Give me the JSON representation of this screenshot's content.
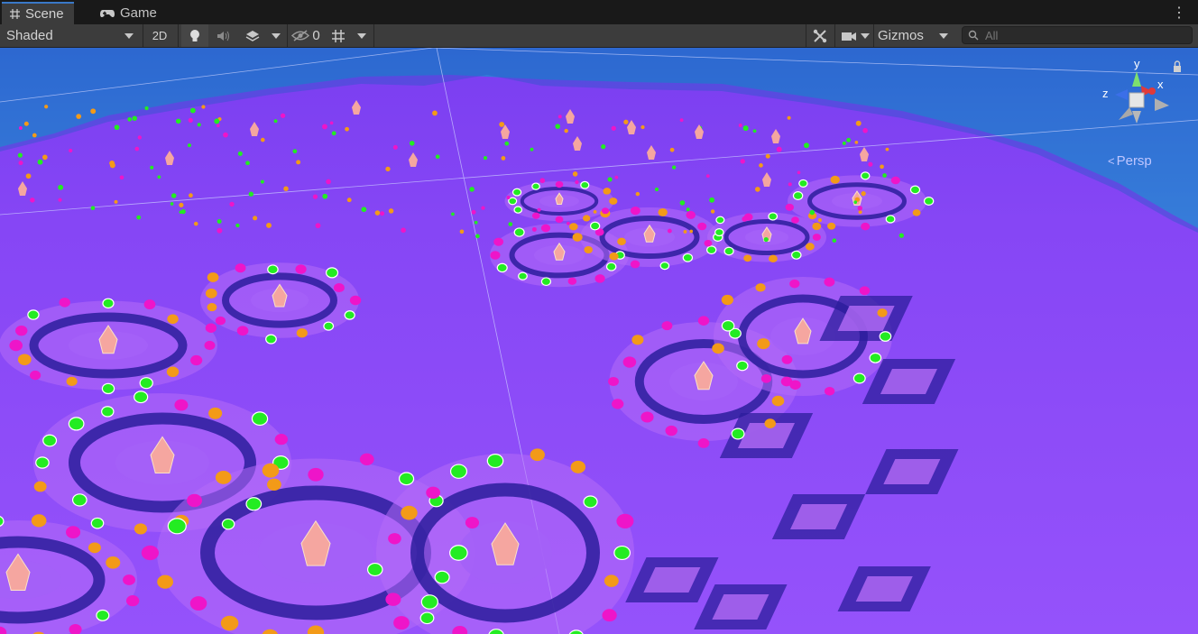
{
  "tabs": [
    {
      "label": "Scene",
      "icon": "grid-hash-icon",
      "active": true
    },
    {
      "label": "Game",
      "icon": "gamepad-icon",
      "active": false
    }
  ],
  "toolbar": {
    "shading_mode": "Shaded",
    "toggle_2d": "2D",
    "hidden_count": "0",
    "gizmos_label": "Gizmos"
  },
  "search": {
    "placeholder": "All"
  },
  "orientation_gizmo": {
    "axis_y": "y",
    "axis_x": "x",
    "axis_z": "z",
    "projection_label": "Persp"
  },
  "colors": {
    "terrain": "#8a4cf5",
    "terrain_dark": "#2c1d9c",
    "tile_light": "#b46bf8",
    "skybox": "#3a7fd6",
    "marker_green": "#23ec22",
    "marker_magenta": "#ee15c9",
    "marker_orange": "#f39a18",
    "crystal": "#f5a6a0",
    "tab_accent": "#3a78c8"
  }
}
